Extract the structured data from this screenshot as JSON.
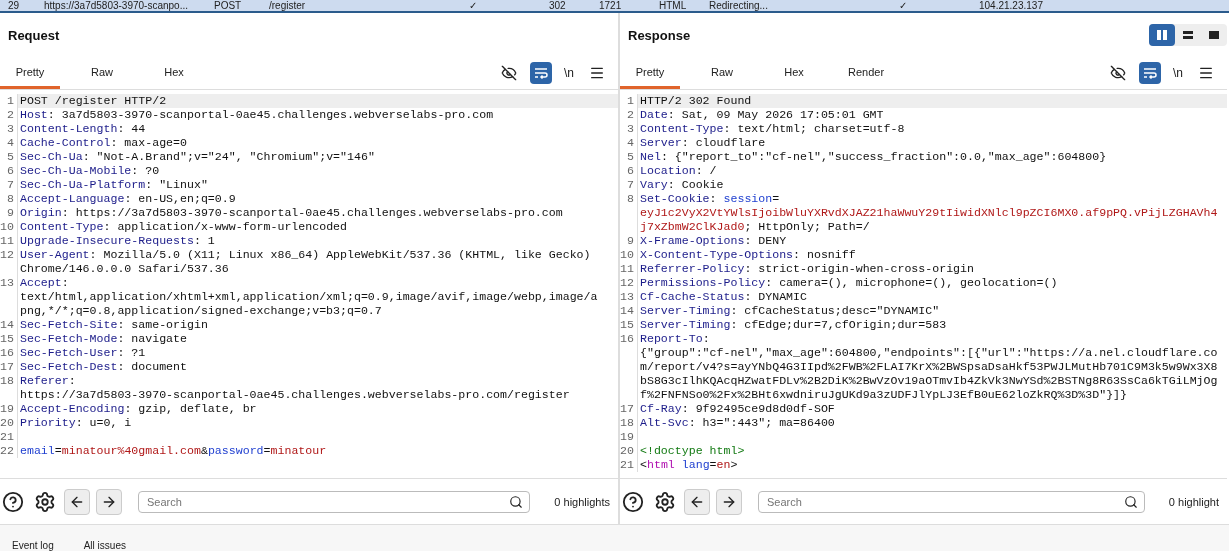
{
  "history_row": {
    "selected": true,
    "cells": [
      "29",
      "https://3a7d5803-3970-scanpo...",
      "POST",
      "/register",
      "✓",
      "302",
      "1721",
      "HTML",
      "Redirecting...",
      "✓",
      "104.21.23.137"
    ]
  },
  "panels": [
    {
      "title": "Request",
      "tabs": [
        {
          "label": "Pretty",
          "selected": true
        },
        {
          "label": "Raw",
          "selected": false
        },
        {
          "label": "Hex",
          "selected": false
        }
      ],
      "wrap_on": true,
      "newline_label": "\\n",
      "search": {
        "placeholder": "Search"
      },
      "highlights": "0 highlights",
      "lines": [
        {
          "number": "1",
          "current": true,
          "rows": [
            {
              "segments": [
                {
                  "kind": "plain",
                  "text": "POST /register HTTP/2"
                }
              ]
            }
          ]
        },
        {
          "number": "2",
          "current": false,
          "rows": [
            {
              "segments": [
                {
                  "kind": "key",
                  "text": "Host"
                },
                {
                  "kind": "plain",
                  "text": ": 3a7d5803-3970-scanportal-0ae45.challenges.webverselabs-pro.com"
                }
              ]
            }
          ]
        },
        {
          "number": "3",
          "current": false,
          "rows": [
            {
              "segments": [
                {
                  "kind": "key",
                  "text": "Content-Length"
                },
                {
                  "kind": "plain",
                  "text": ": 44"
                }
              ]
            }
          ]
        },
        {
          "number": "4",
          "current": false,
          "rows": [
            {
              "segments": [
                {
                  "kind": "key",
                  "text": "Cache-Control"
                },
                {
                  "kind": "plain",
                  "text": ": max-age=0"
                }
              ]
            }
          ]
        },
        {
          "number": "5",
          "current": false,
          "rows": [
            {
              "segments": [
                {
                  "kind": "key",
                  "text": "Sec-Ch-Ua"
                },
                {
                  "kind": "plain",
                  "text": ": \"Not-A.Brand\";v=\"24\", \"Chromium\";v=\"146\""
                }
              ]
            }
          ]
        },
        {
          "number": "6",
          "current": false,
          "rows": [
            {
              "segments": [
                {
                  "kind": "key",
                  "text": "Sec-Ch-Ua-Mobile"
                },
                {
                  "kind": "plain",
                  "text": ": ?0"
                }
              ]
            }
          ]
        },
        {
          "number": "7",
          "current": false,
          "rows": [
            {
              "segments": [
                {
                  "kind": "key",
                  "text": "Sec-Ch-Ua-Platform"
                },
                {
                  "kind": "plain",
                  "text": ": \"Linux\""
                }
              ]
            }
          ]
        },
        {
          "number": "8",
          "current": false,
          "rows": [
            {
              "segments": [
                {
                  "kind": "key",
                  "text": "Accept-Language"
                },
                {
                  "kind": "plain",
                  "text": ": en-US,en;q=0.9"
                }
              ]
            }
          ]
        },
        {
          "number": "9",
          "current": false,
          "rows": [
            {
              "segments": [
                {
                  "kind": "key",
                  "text": "Origin"
                },
                {
                  "kind": "plain",
                  "text": ": https://3a7d5803-3970-scanportal-0ae45.challenges.webverselabs-pro.com"
                }
              ]
            }
          ]
        },
        {
          "number": "10",
          "current": false,
          "rows": [
            {
              "segments": [
                {
                  "kind": "key",
                  "text": "Content-Type"
                },
                {
                  "kind": "plain",
                  "text": ": application/x-www-form-urlencoded"
                }
              ]
            }
          ]
        },
        {
          "number": "11",
          "current": false,
          "rows": [
            {
              "segments": [
                {
                  "kind": "key",
                  "text": "Upgrade-Insecure-Requests"
                },
                {
                  "kind": "plain",
                  "text": ": 1"
                }
              ]
            }
          ]
        },
        {
          "number": "12",
          "current": false,
          "rows": [
            {
              "segments": [
                {
                  "kind": "key",
                  "text": "User-Agent"
                },
                {
                  "kind": "plain",
                  "text": ": Mozilla/5.0 (X11; Linux x86_64) AppleWebKit/537.36 (KHTML, like Gecko)"
                }
              ]
            },
            {
              "segments": [
                {
                  "kind": "plain",
                  "text": "Chrome/146.0.0.0 Safari/537.36"
                }
              ]
            }
          ]
        },
        {
          "number": "13",
          "current": false,
          "rows": [
            {
              "segments": [
                {
                  "kind": "key",
                  "text": "Accept"
                },
                {
                  "kind": "plain",
                  "text": ":"
                }
              ]
            },
            {
              "segments": [
                {
                  "kind": "plain",
                  "text": "text/html,application/xhtml+xml,application/xml;q=0.9,image/avif,image/webp,image/a"
                }
              ]
            },
            {
              "segments": [
                {
                  "kind": "plain",
                  "text": "png,*/*;q=0.8,application/signed-exchange;v=b3;q=0.7"
                }
              ]
            }
          ]
        },
        {
          "number": "14",
          "current": false,
          "rows": [
            {
              "segments": [
                {
                  "kind": "key",
                  "text": "Sec-Fetch-Site"
                },
                {
                  "kind": "plain",
                  "text": ": same-origin"
                }
              ]
            }
          ]
        },
        {
          "number": "15",
          "current": false,
          "rows": [
            {
              "segments": [
                {
                  "kind": "key",
                  "text": "Sec-Fetch-Mode"
                },
                {
                  "kind": "plain",
                  "text": ": navigate"
                }
              ]
            }
          ]
        },
        {
          "number": "16",
          "current": false,
          "rows": [
            {
              "segments": [
                {
                  "kind": "key",
                  "text": "Sec-Fetch-User"
                },
                {
                  "kind": "plain",
                  "text": ": ?1"
                }
              ]
            }
          ]
        },
        {
          "number": "17",
          "current": false,
          "rows": [
            {
              "segments": [
                {
                  "kind": "key",
                  "text": "Sec-Fetch-Dest"
                },
                {
                  "kind": "plain",
                  "text": ": document"
                }
              ]
            }
          ]
        },
        {
          "number": "18",
          "current": false,
          "rows": [
            {
              "segments": [
                {
                  "kind": "key",
                  "text": "Referer"
                },
                {
                  "kind": "plain",
                  "text": ":"
                }
              ]
            },
            {
              "segments": [
                {
                  "kind": "plain",
                  "text": "https://3a7d5803-3970-scanportal-0ae45.challenges.webverselabs-pro.com/register"
                }
              ]
            }
          ]
        },
        {
          "number": "19",
          "current": false,
          "rows": [
            {
              "segments": [
                {
                  "kind": "key",
                  "text": "Accept-Encoding"
                },
                {
                  "kind": "plain",
                  "text": ": gzip, deflate, br"
                }
              ]
            }
          ]
        },
        {
          "number": "20",
          "current": false,
          "rows": [
            {
              "segments": [
                {
                  "kind": "key",
                  "text": "Priority"
                },
                {
                  "kind": "plain",
                  "text": ": u=0, i"
                }
              ]
            }
          ]
        },
        {
          "number": "21",
          "current": false
        },
        {
          "number": "22",
          "current": false,
          "rows": [
            {
              "segments": [
                {
                  "kind": "param",
                  "text": "email"
                },
                {
                  "kind": "plain",
                  "text": "="
                },
                {
                  "kind": "value",
                  "text": "minatour%40gmail.com"
                },
                {
                  "kind": "plain",
                  "text": "&"
                },
                {
                  "kind": "param",
                  "text": "password"
                },
                {
                  "kind": "plain",
                  "text": "="
                },
                {
                  "kind": "value",
                  "text": "minatour"
                }
              ]
            }
          ]
        }
      ]
    },
    {
      "title": "Response",
      "layout_toggle": [
        {
          "kind": "columns",
          "selected": true
        },
        {
          "kind": "rows",
          "selected": false
        },
        {
          "kind": "single",
          "selected": false
        }
      ],
      "tabs": [
        {
          "label": "Pretty",
          "selected": true
        },
        {
          "label": "Raw",
          "selected": false
        },
        {
          "label": "Hex",
          "selected": false
        },
        {
          "label": "Render",
          "selected": false
        }
      ],
      "wrap_on": true,
      "newline_label": "\\n",
      "search": {
        "placeholder": "Search"
      },
      "highlights": "0 highlight",
      "lines": [
        {
          "number": "1",
          "current": true,
          "rows": [
            {
              "segments": [
                {
                  "kind": "plain",
                  "text": "HTTP/2 302 Found"
                }
              ]
            }
          ]
        },
        {
          "number": "2",
          "current": false,
          "rows": [
            {
              "segments": [
                {
                  "kind": "key",
                  "text": "Date"
                },
                {
                  "kind": "plain",
                  "text": ": Sat, 09 May 2026 17:05:01 GMT"
                }
              ]
            }
          ]
        },
        {
          "number": "3",
          "current": false,
          "rows": [
            {
              "segments": [
                {
                  "kind": "key",
                  "text": "Content-Type"
                },
                {
                  "kind": "plain",
                  "text": ": text/html; charset=utf-8"
                }
              ]
            }
          ]
        },
        {
          "number": "4",
          "current": false,
          "rows": [
            {
              "segments": [
                {
                  "kind": "key",
                  "text": "Server"
                },
                {
                  "kind": "plain",
                  "text": ": cloudflare"
                }
              ]
            }
          ]
        },
        {
          "number": "5",
          "current": false,
          "rows": [
            {
              "segments": [
                {
                  "kind": "key",
                  "text": "Nel"
                },
                {
                  "kind": "plain",
                  "text": ": {\"report_to\":\"cf-nel\",\"success_fraction\":0.0,\"max_age\":604800}"
                }
              ]
            }
          ]
        },
        {
          "number": "6",
          "current": false,
          "rows": [
            {
              "segments": [
                {
                  "kind": "key",
                  "text": "Location"
                },
                {
                  "kind": "plain",
                  "text": ": /"
                }
              ]
            }
          ]
        },
        {
          "number": "7",
          "current": false,
          "rows": [
            {
              "segments": [
                {
                  "kind": "key",
                  "text": "Vary"
                },
                {
                  "kind": "plain",
                  "text": ": Cookie"
                }
              ]
            }
          ]
        },
        {
          "number": "8",
          "current": false,
          "rows": [
            {
              "segments": [
                {
                  "kind": "key",
                  "text": "Set-Cookie"
                },
                {
                  "kind": "plain",
                  "text": ":"
                },
                {
                  "kind": "param",
                  "text": " session"
                },
                {
                  "kind": "plain",
                  "text": "="
                }
              ]
            },
            {
              "segments": [
                {
                  "kind": "value",
                  "text": "eyJ1c2VyX2VtYWlsIjoibWluYXRvdXJAZ21haWwuY29tIiwidXNlcl9pZCI6MX0.af9pPQ.vPijLZGHAVh4"
                }
              ]
            },
            {
              "segments": [
                {
                  "kind": "value",
                  "text": "j7xZbmW2ClKJad0"
                },
                {
                  "kind": "plain",
                  "text": "; HttpOnly; Path=/"
                }
              ]
            }
          ]
        },
        {
          "number": "9",
          "current": false,
          "rows": [
            {
              "segments": [
                {
                  "kind": "key",
                  "text": "X-Frame-Options"
                },
                {
                  "kind": "plain",
                  "text": ": DENY"
                }
              ]
            }
          ]
        },
        {
          "number": "10",
          "current": false,
          "rows": [
            {
              "segments": [
                {
                  "kind": "key",
                  "text": "X-Content-Type-Options"
                },
                {
                  "kind": "plain",
                  "text": ": nosniff"
                }
              ]
            }
          ]
        },
        {
          "number": "11",
          "current": false,
          "rows": [
            {
              "segments": [
                {
                  "kind": "key",
                  "text": "Referrer-Policy"
                },
                {
                  "kind": "plain",
                  "text": ": strict-origin-when-cross-origin"
                }
              ]
            }
          ]
        },
        {
          "number": "12",
          "current": false,
          "rows": [
            {
              "segments": [
                {
                  "kind": "key",
                  "text": "Permissions-Policy"
                },
                {
                  "kind": "plain",
                  "text": ": camera=(), microphone=(), geolocation=()"
                }
              ]
            }
          ]
        },
        {
          "number": "13",
          "current": false,
          "rows": [
            {
              "segments": [
                {
                  "kind": "key",
                  "text": "Cf-Cache-Status"
                },
                {
                  "kind": "plain",
                  "text": ": DYNAMIC"
                }
              ]
            }
          ]
        },
        {
          "number": "14",
          "current": false,
          "rows": [
            {
              "segments": [
                {
                  "kind": "key",
                  "text": "Server-Timing"
                },
                {
                  "kind": "plain",
                  "text": ": cfCacheStatus;desc=\"DYNAMIC\""
                }
              ]
            }
          ]
        },
        {
          "number": "15",
          "current": false,
          "rows": [
            {
              "segments": [
                {
                  "kind": "key",
                  "text": "Server-Timing"
                },
                {
                  "kind": "plain",
                  "text": ": cfEdge;dur=7,cfOrigin;dur=583"
                }
              ]
            }
          ]
        },
        {
          "number": "16",
          "current": false,
          "rows": [
            {
              "segments": [
                {
                  "kind": "key",
                  "text": "Report-To"
                },
                {
                  "kind": "plain",
                  "text": ":"
                }
              ]
            },
            {
              "segments": [
                {
                  "kind": "plain",
                  "text": "{\"group\":\"cf-nel\",\"max_age\":604800,\"endpoints\":[{\"url\":\"https://a.nel.cloudflare.co"
                }
              ]
            },
            {
              "segments": [
                {
                  "kind": "plain",
                  "text": "m/report/v4?s=ayYNbQ4G3IIpd%2FWB%2FLAI7KrX%2BWSpsaDsaHkf53PWJLMutHb701C9M3k5w9Wx3X8"
                }
              ]
            },
            {
              "segments": [
                {
                  "kind": "plain",
                  "text": "bS8G3cIlhKQAcqHZwatFDLv%2B2DiK%2BwVzOv19aOTmvIb4ZkVk3NwYSd%2BSTNg8R63SsCa6kTGiLMjOg"
                }
              ]
            },
            {
              "segments": [
                {
                  "kind": "plain",
                  "text": "f%2FNFNSo0%2Fx%2BHt6xwdniruJgUKd9a3zUDFJlYpLJ3EfB0uE62loZkRQ%3D%3D\"}]}"
                }
              ]
            }
          ]
        },
        {
          "number": "17",
          "current": false,
          "rows": [
            {
              "segments": [
                {
                  "kind": "key",
                  "text": "Cf-Ray"
                },
                {
                  "kind": "plain",
                  "text": ": 9f92495ce9d8d0df-SOF"
                }
              ]
            }
          ]
        },
        {
          "number": "18",
          "current": false,
          "rows": [
            {
              "segments": [
                {
                  "kind": "key",
                  "text": "Alt-Svc"
                },
                {
                  "kind": "plain",
                  "text": ": h3=\":443\"; ma=86400"
                }
              ]
            }
          ]
        },
        {
          "number": "19",
          "current": false
        },
        {
          "number": "20",
          "current": false,
          "rows": [
            {
              "segments": [
                {
                  "kind": "doctype",
                  "text": "<!doctype html>"
                }
              ]
            }
          ]
        },
        {
          "number": "21",
          "current": false,
          "rows": [
            {
              "segments": [
                {
                  "kind": "plain",
                  "text": "<"
                },
                {
                  "kind": "tag",
                  "text": "html"
                },
                {
                  "kind": "attr",
                  "text": " lang"
                },
                {
                  "kind": "plain",
                  "text": "="
                },
                {
                  "kind": "value",
                  "text": "en"
                },
                {
                  "kind": "plain",
                  "text": ">"
                }
              ]
            }
          ]
        }
      ]
    }
  ],
  "bottom_tabs": [
    "Event log",
    "All issues"
  ]
}
